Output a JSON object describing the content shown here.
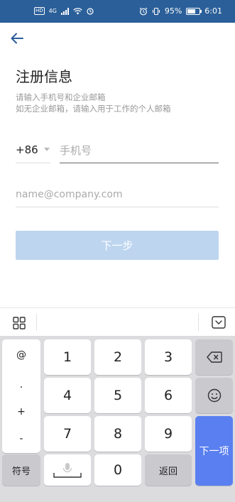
{
  "status_bar": {
    "network_badge": "HD",
    "signal_label": "4G",
    "battery_percent": "95%",
    "time": "6:01"
  },
  "page": {
    "title": "注册信息",
    "subtitle_line1": "请输入手机号和企业邮箱",
    "subtitle_line2": "如无企业邮箱，请输入用于工作的个人邮箱"
  },
  "form": {
    "country_code": "+86",
    "phone_placeholder": "手机号",
    "phone_value": "",
    "email_placeholder": "name@company.com",
    "email_value": ""
  },
  "next_button": {
    "label": "下一步",
    "enabled": false
  },
  "keyboard": {
    "symbols": [
      "@",
      ".",
      "+",
      "-"
    ],
    "digits": [
      "1",
      "2",
      "3",
      "4",
      "5",
      "6",
      "7",
      "8",
      "9",
      "0"
    ],
    "symbols_key": "符号",
    "return_key": "返回",
    "next_key": "下一项"
  },
  "colors": {
    "status_bar": "#2b5f99",
    "primary_disabled": "#bdd5ef",
    "keyboard_accent": "#5a7ff0"
  }
}
